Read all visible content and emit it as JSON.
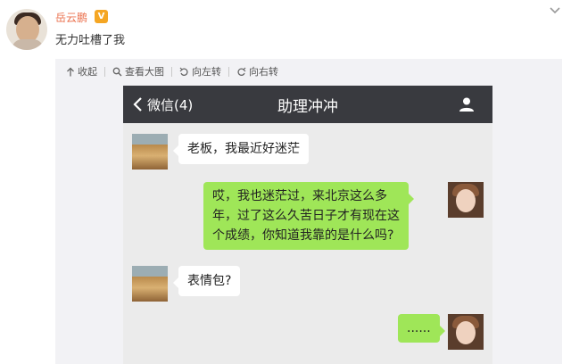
{
  "post": {
    "username": "岳云鹏",
    "verified_badge": "V",
    "text": "无力吐槽了我",
    "menu_icon": "chevron-down-icon"
  },
  "toolbar": {
    "collapse": "收起",
    "view_large": "查看大图",
    "rotate_left": "向左转",
    "rotate_right": "向右转"
  },
  "chat": {
    "back_label": "微信(4)",
    "title": "助理冲冲",
    "messages": [
      {
        "side": "left",
        "lines": [
          "老板，我最近好迷茫"
        ]
      },
      {
        "side": "right",
        "lines": [
          "哎，我也迷茫过，来北京这么多",
          "年，过了这么久苦日子才有现在这",
          "个成绩，你知道我靠的是什么吗?"
        ]
      },
      {
        "side": "left",
        "lines": [
          "表情包?"
        ]
      },
      {
        "side": "right",
        "lines": [
          "......"
        ]
      }
    ]
  },
  "colors": {
    "username": "#eb7350",
    "verified": "#f5a623",
    "chat_topbar": "#393a3f",
    "chat_background": "#ebebeb",
    "bubble_right": "#9fe658",
    "bubble_left": "#ffffff"
  }
}
